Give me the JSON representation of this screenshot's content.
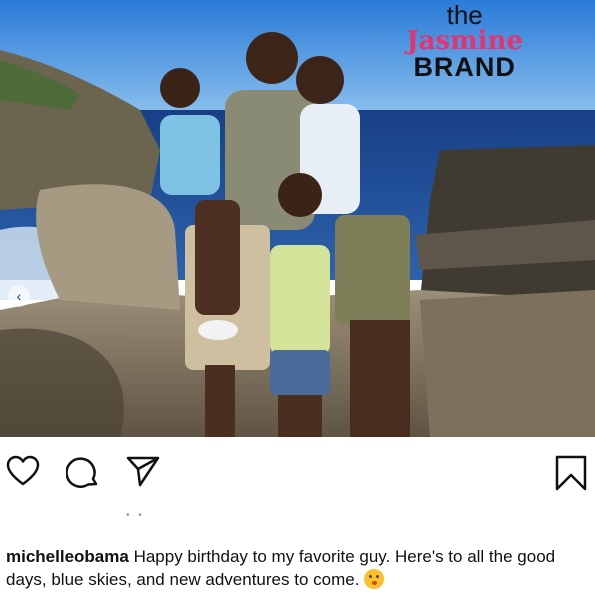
{
  "post": {
    "watermark": {
      "line1": "the",
      "line2": "Jasmine",
      "line3": "BRAND"
    },
    "carousel_icon": "chevron-left-icon"
  },
  "actions": {
    "like_icon": "heart-icon",
    "comment_icon": "comment-icon",
    "share_icon": "send-icon",
    "save_icon": "bookmark-icon"
  },
  "caption": {
    "username": "michelleobama",
    "text": "Happy birthday to my favorite guy. Here's to all the good days, blue skies, and new adventures to come.",
    "emoji": "kissing-face-emoji"
  },
  "colors": {
    "sky": "#2f7fd6",
    "ocean": "#1e4f9a",
    "rock": "#8a7e6a",
    "watermark_pink": "#e8326e"
  }
}
